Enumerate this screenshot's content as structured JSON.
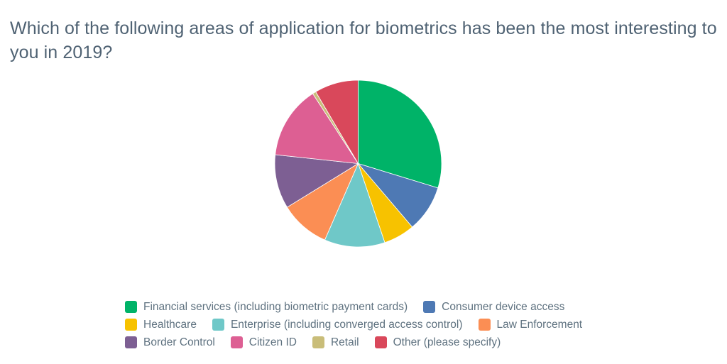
{
  "title": "Which of the following areas of application for biometrics has been the most interesting to you in 2019?",
  "chart_data": {
    "type": "pie",
    "title": "Which of the following areas of application for biometrics has been the most interesting to you in 2019?",
    "xlabel": "",
    "ylabel": "",
    "legend_position": "bottom",
    "grid": false,
    "start_angle_deg": 0,
    "direction": "clockwise",
    "categories": [
      "Financial services (including biometric payment cards)",
      "Consumer device access",
      "Healthcare",
      "Enterprise (including converged access control)",
      "Law Enforcement",
      "Border Control",
      "Citizen ID",
      "Retail",
      "Other (please specify)"
    ],
    "values": [
      29.7,
      9.1,
      6.1,
      11.7,
      9.7,
      10.5,
      14.1,
      0.7,
      8.5
    ],
    "colors": [
      "#00b368",
      "#4e79b4",
      "#f7c200",
      "#6fc8c8",
      "#fb8e54",
      "#7d5f93",
      "#dd5f93",
      "#c9bd79",
      "#d9485b"
    ],
    "slices": [
      {
        "label": "Financial services (including biometric payment cards)",
        "value": 29.7,
        "color": "#00b368",
        "start_deg": 0.0,
        "end_deg": 107.0
      },
      {
        "label": "Consumer device access",
        "value": 9.1,
        "color": "#4e79b4",
        "start_deg": 107.0,
        "end_deg": 139.6
      },
      {
        "label": "Healthcare",
        "value": 6.1,
        "color": "#f7c200",
        "start_deg": 139.6,
        "end_deg": 161.4
      },
      {
        "label": "Enterprise (including converged access control)",
        "value": 11.7,
        "color": "#6fc8c8",
        "start_deg": 161.4,
        "end_deg": 203.6
      },
      {
        "label": "Law Enforcement",
        "value": 9.7,
        "color": "#fb8e54",
        "start_deg": 203.6,
        "end_deg": 238.4
      },
      {
        "label": "Border Control",
        "value": 10.5,
        "color": "#7d5f93",
        "start_deg": 238.4,
        "end_deg": 276.1
      },
      {
        "label": "Citizen ID",
        "value": 14.1,
        "color": "#dd5f93",
        "start_deg": 276.1,
        "end_deg": 327.0
      },
      {
        "label": "Retail",
        "value": 0.7,
        "color": "#c9bd79",
        "start_deg": 327.0,
        "end_deg": 329.4
      },
      {
        "label": "Other (please specify)",
        "value": 8.5,
        "color": "#d9485b",
        "start_deg": 329.4,
        "end_deg": 360.0
      }
    ]
  },
  "legend": {
    "rows": [
      [
        {
          "label": "Financial services (including biometric payment cards)",
          "color": "#00b368"
        },
        {
          "label": "Consumer device access",
          "color": "#4e79b4"
        }
      ],
      [
        {
          "label": "Healthcare",
          "color": "#f7c200"
        },
        {
          "label": "Enterprise (including converged access control)",
          "color": "#6fc8c8"
        },
        {
          "label": "Law Enforcement",
          "color": "#fb8e54"
        }
      ],
      [
        {
          "label": "Border Control",
          "color": "#7d5f93"
        },
        {
          "label": "Citizen ID",
          "color": "#dd5f93"
        },
        {
          "label": "Retail",
          "color": "#c9bd79"
        },
        {
          "label": "Other (please specify)",
          "color": "#d9485b"
        }
      ]
    ]
  }
}
